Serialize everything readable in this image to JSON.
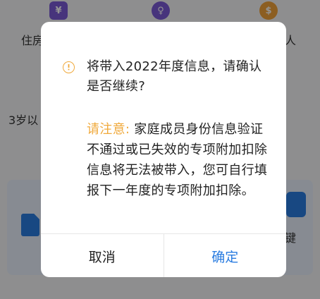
{
  "background": {
    "icons": [
      "house-yuan-icon",
      "medal-icon",
      "money-bag-icon"
    ],
    "housing_label": "住房",
    "right_label_top": "人",
    "age_label": "3岁以",
    "right_label_bottom": "键"
  },
  "dialog": {
    "icon": "warning-circle-icon",
    "message": "将带入2022年度信息，请确认是否继续?",
    "note_label": "请注意:",
    "note_text": "家庭成员身份信息验证不通过或已失效的专项附加扣除信息将无法被带入，您可自行填报下一年度的专项附加扣除。",
    "cancel_label": "取消",
    "confirm_label": "确定"
  },
  "colors": {
    "accent": "#2a7ce0",
    "warning": "#f0a93b",
    "overlay": "rgba(0,0,0,0.42)"
  }
}
